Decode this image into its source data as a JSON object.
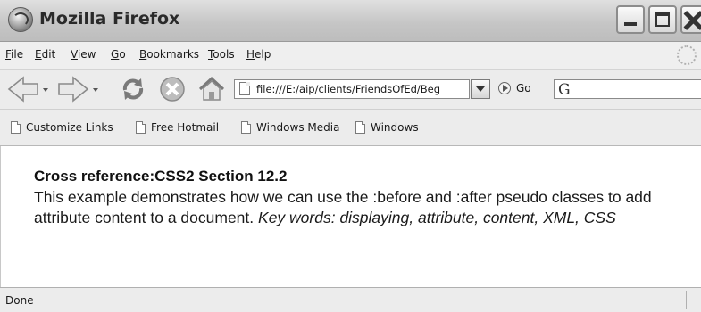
{
  "window": {
    "title": "Mozilla Firefox",
    "app_icon": "firefox-icon",
    "controls": [
      "minimize-icon",
      "maximize-icon",
      "close-icon"
    ]
  },
  "menubar": {
    "items": [
      "File",
      "Edit",
      "View",
      "Go",
      "Bookmarks",
      "Tools",
      "Help"
    ]
  },
  "navbar": {
    "icons": [
      "back-arrow-icon",
      "forward-arrow-icon",
      "reload-icon",
      "stop-icon",
      "home-icon"
    ],
    "url": "file:///E:/aip/clients/FriendsOfEd/Beg",
    "go_label": "Go",
    "search_engine_icon": "google-icon",
    "search_value": ""
  },
  "bookmarks": {
    "items": [
      "Customize Links",
      "Free Hotmail",
      "Windows Media",
      "Windows"
    ]
  },
  "content": {
    "heading": "Cross reference:CSS2 Section 12.2",
    "body_text": "This example demonstrates how we can use the :before and :after pseudo classes to add attribute content to a document.",
    "keywords": "Key words: displaying, attribute, content, XML, CSS"
  },
  "statusbar": {
    "text": "Done"
  }
}
